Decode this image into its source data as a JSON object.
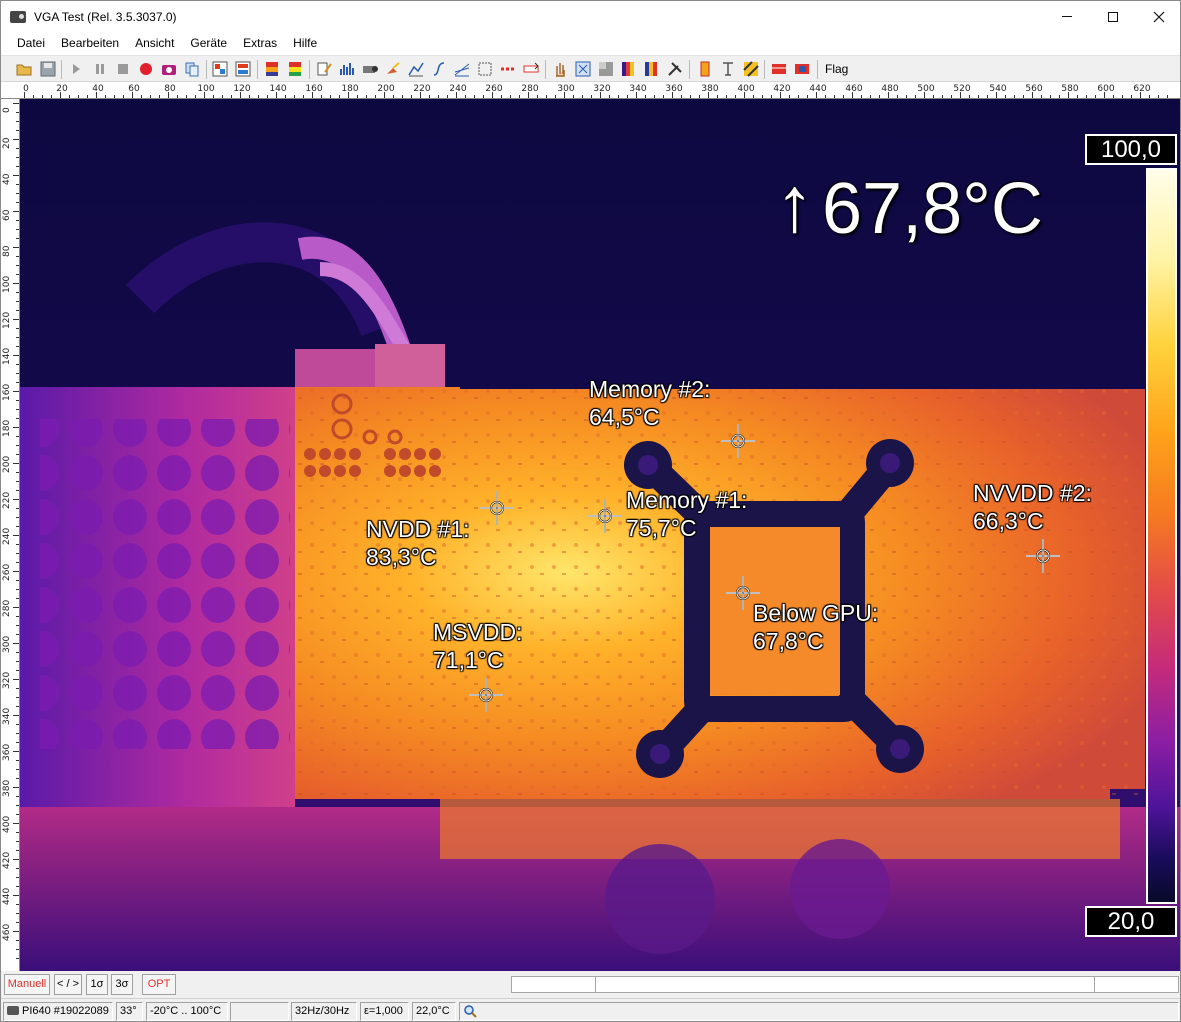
{
  "window": {
    "title": "VGA Test (Rel. 3.5.3037.0)"
  },
  "menu": [
    "Datei",
    "Bearbeiten",
    "Ansicht",
    "Geräte",
    "Extras",
    "Hilfe"
  ],
  "toolbar": {
    "flag_label": "Flag"
  },
  "ruler": {
    "x_labels": [
      "0",
      "20",
      "40",
      "60",
      "80",
      "100",
      "120",
      "140",
      "160",
      "180",
      "200",
      "220",
      "240",
      "260",
      "280",
      "300",
      "320",
      "340",
      "360",
      "380",
      "400",
      "420",
      "440",
      "460",
      "480",
      "500",
      "520",
      "540",
      "560",
      "580",
      "600",
      "620"
    ],
    "y_labels": [
      "0",
      "20",
      "40",
      "60",
      "80",
      "100",
      "120",
      "140",
      "160",
      "180",
      "200",
      "220",
      "240",
      "260",
      "280",
      "300",
      "320",
      "340",
      "360",
      "380",
      "400",
      "420",
      "440",
      "460"
    ]
  },
  "thermal": {
    "max_readout": "67,8°C",
    "max_arrow": "↑",
    "scale_max": "100,0",
    "scale_min": "20,0",
    "measurements": [
      {
        "name": "Memory #2:",
        "value": "64,5°C"
      },
      {
        "name": "Memory #1:",
        "value": "75,7°C"
      },
      {
        "name": "NVDD #1:",
        "value": "83,3°C"
      },
      {
        "name": "NVVDD #2:",
        "value": "66,3°C"
      },
      {
        "name": "MSVDD:",
        "value": "71,1°C"
      },
      {
        "name": "Below GPU:",
        "value": "67,8°C"
      }
    ]
  },
  "bottom_buttons": [
    "Manuell",
    "< / >",
    "1σ",
    "3σ",
    "OPT"
  ],
  "status": {
    "device": "PI640 #19022089",
    "fov": "33°",
    "range": "-20°C .. 100°C",
    "blank": "",
    "framerate": "32Hz/30Hz",
    "emissivity": "ε=1,000",
    "ambient": "22,0°C"
  },
  "colors": {
    "accent_red": "#e0302a",
    "scale_top": "#fffde8",
    "scale_bottom": "#080a2a"
  }
}
